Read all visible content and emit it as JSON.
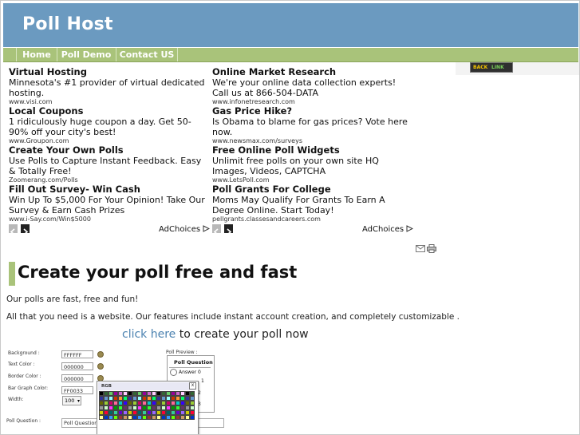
{
  "site": {
    "title": "Poll Host"
  },
  "nav": {
    "home": "Home",
    "demo": "Poll Demo",
    "contact": "Contact US"
  },
  "backlink": {
    "left": "BACK",
    "right": "LINK"
  },
  "ads_left": [
    {
      "title": "Virtual Hosting",
      "desc": "Minnesota's #1 provider of virtual dedicated hosting.",
      "url": "www.visi.com"
    },
    {
      "title": "Local Coupons",
      "desc": "1 ridiculously huge coupon a day. Get 50-90% off your city's best!",
      "url": "www.Groupon.com"
    },
    {
      "title": "Create Your Own Polls",
      "desc": "Use Polls to Capture Instant Feedback. Easy & Totally Free!",
      "url": "Zoomerang.com/Polls"
    },
    {
      "title": "Fill Out Survey- Win Cash",
      "desc": "Win Up To $5,000 For Your Opinion! Take Our Survey & Earn Cash Prizes",
      "url": "www.i-Say.com/Win$5000"
    }
  ],
  "ads_right": [
    {
      "title": "Online Market Research",
      "desc": "We're your online data collection experts! Call us at 866-504-DATA",
      "url": "www.infonetresearch.com"
    },
    {
      "title": "Gas Price Hike?",
      "desc": "Is Obama to blame for gas prices? Vote here now.",
      "url": "www.newsmax.com/surveys"
    },
    {
      "title": "Free Online Poll Widgets",
      "desc": "Unlimit free polls on your own site HQ Images, Videos, CAPTCHA",
      "url": "www.LetsPoll.com"
    },
    {
      "title": "Poll Grants For College",
      "desc": "Moms May Qualify For Grants To Earn A Degree Online. Start Today!",
      "url": "pellgrants.classesandcareers.com"
    }
  ],
  "adchoices": "AdChoices",
  "icons": {
    "prev": "chevron-left-icon",
    "next": "chevron-right-icon",
    "email": "email-icon",
    "print": "printer-icon",
    "adchoices": "adchoices-icon",
    "color_picker": "palette-icon"
  },
  "main": {
    "heading": "Create your poll free and fast",
    "para1": "Our polls are fast, free and fun!",
    "para2": "All that you need is a website. Our features include instant account creation, and completely customizable .",
    "cta_link": "click here",
    "cta_rest": "to create your poll now"
  },
  "form": {
    "background_label": "Background :",
    "background_value": "FFFFFF",
    "text_color_label": "Text Color :",
    "text_color_value": "000000",
    "border_color_label": "Border Color :",
    "border_color_value": "000000",
    "bar_graph_label": "Bar Graph Color:",
    "bar_graph_value": "FF0033",
    "width_label": "Width:",
    "width_value": "100",
    "poll_question_label": "Poll Question :",
    "poll_question_value": "Poll Question"
  },
  "preview": {
    "label": "Poll Preview :",
    "question": "Poll Question",
    "answers": [
      "Answer 0",
      "1",
      "2",
      "3"
    ]
  },
  "picker": {
    "title": "RGB",
    "close": "x"
  },
  "colors": {
    "header": "#6b9ac0",
    "nav": "#a9c37a",
    "link": "#4b82b0"
  }
}
